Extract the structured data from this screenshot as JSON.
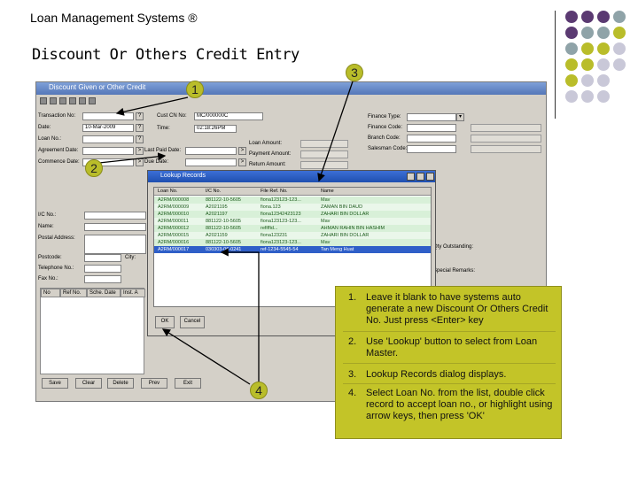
{
  "header": {
    "app_title": "Loan Management Systems ®",
    "slide_title": "Discount Or Others Credit Entry"
  },
  "callouts": [
    "1",
    "2",
    "3",
    "4"
  ],
  "window": {
    "title": "Discount Given or Other Credit",
    "fields": {
      "transaction_no": "Transaction No:",
      "date": "Date:",
      "date_value": "10-Mar-2009",
      "loan_no": "Loan No.:",
      "agreement_date": "Agreement Date:",
      "commence_date": "Commence Date:",
      "last_paid_date": "Last Paid Date:",
      "due_date": "Due Date:",
      "cust_cn_no": "Cust CN No:",
      "cust_cn_value": "MC/000000C",
      "time": "Time:",
      "time_value": "02:18:26PM",
      "loan_amount": "Loan Amount:",
      "payment_amount": "Payment Amount:",
      "return_amount": "Return Amount:",
      "finance_type": "Finance Type:",
      "finance_code": "Finance Code:",
      "branch_code": "Branch Code:",
      "salesman_code": "Salesman Code:",
      "ic_no": "I/C No.:",
      "name": "Name:",
      "postal_address": "Postal Address:",
      "postcode": "Postcode:",
      "city": "City:",
      "telephone": "Telephone No.:",
      "fax_no": "Fax No.:",
      "qty_outstanding": "Qty Outstanding:",
      "special_remarks": "Special Remarks:"
    },
    "grid_headers": [
      "No",
      "Ref No.",
      "Sche. Date",
      "Inst. A"
    ],
    "buttons": [
      "Save",
      "Clear",
      "Delete",
      "Prev",
      "Exit"
    ]
  },
  "lookup": {
    "title": "Lookup Records",
    "columns": [
      "Loan No.",
      "I/C No.",
      "File Ref. No.",
      "Name"
    ],
    "rows": [
      [
        "A2RM/000008",
        "881122-10-5605",
        "fiona123123-123...",
        "Mav"
      ],
      [
        "A2RM/000009",
        "A2021195",
        "fiona.123",
        "ZAMAN BIN DAUD"
      ],
      [
        "A2RM/000010",
        "A2021197",
        "fiona12342423123",
        "ZAHARI BIN DOLLAR"
      ],
      [
        "A2RM/000011",
        "881122-10-5605",
        "fiona123123-123...",
        "Mav"
      ],
      [
        "A2RM/000012",
        "881122-10-5605",
        "refiffid...",
        "AHMAN RAHIN BIN HASHIM"
      ],
      [
        "A2RM/000015",
        "A2021159",
        "fiona123231",
        "ZAHARI BIN DOLLAR"
      ],
      [
        "A2RM/000016",
        "881122-10-5605",
        "fiona123123-123...",
        "Mav"
      ],
      [
        "A2RM/000017",
        "030303-06-0241",
        "ref-1234-5545-54",
        "Tan Meng Huat"
      ]
    ],
    "selected_row": 7,
    "ok_label": "OK",
    "cancel_label": "Cancel"
  },
  "instructions": [
    {
      "num": "1.",
      "text": "Leave it blank to have systems auto generate a new Discount Or Others Credit No. Just press <Enter> key"
    },
    {
      "num": "2.",
      "text": "Use 'Lookup' button to select from Loan Master."
    },
    {
      "num": "3.",
      "text": "Lookup Records dialog displays."
    },
    {
      "num": "4.",
      "text": "Select Loan No. from the list, double click record to accept loan no., or highlight using arrow keys, then press 'OK'"
    }
  ],
  "colors": {
    "purple": "#5b3a72",
    "teal": "#8fa3a8",
    "olive": "#b9bd2a",
    "lavender": "#c9c8d8",
    "note_bg": "#c3c428"
  }
}
